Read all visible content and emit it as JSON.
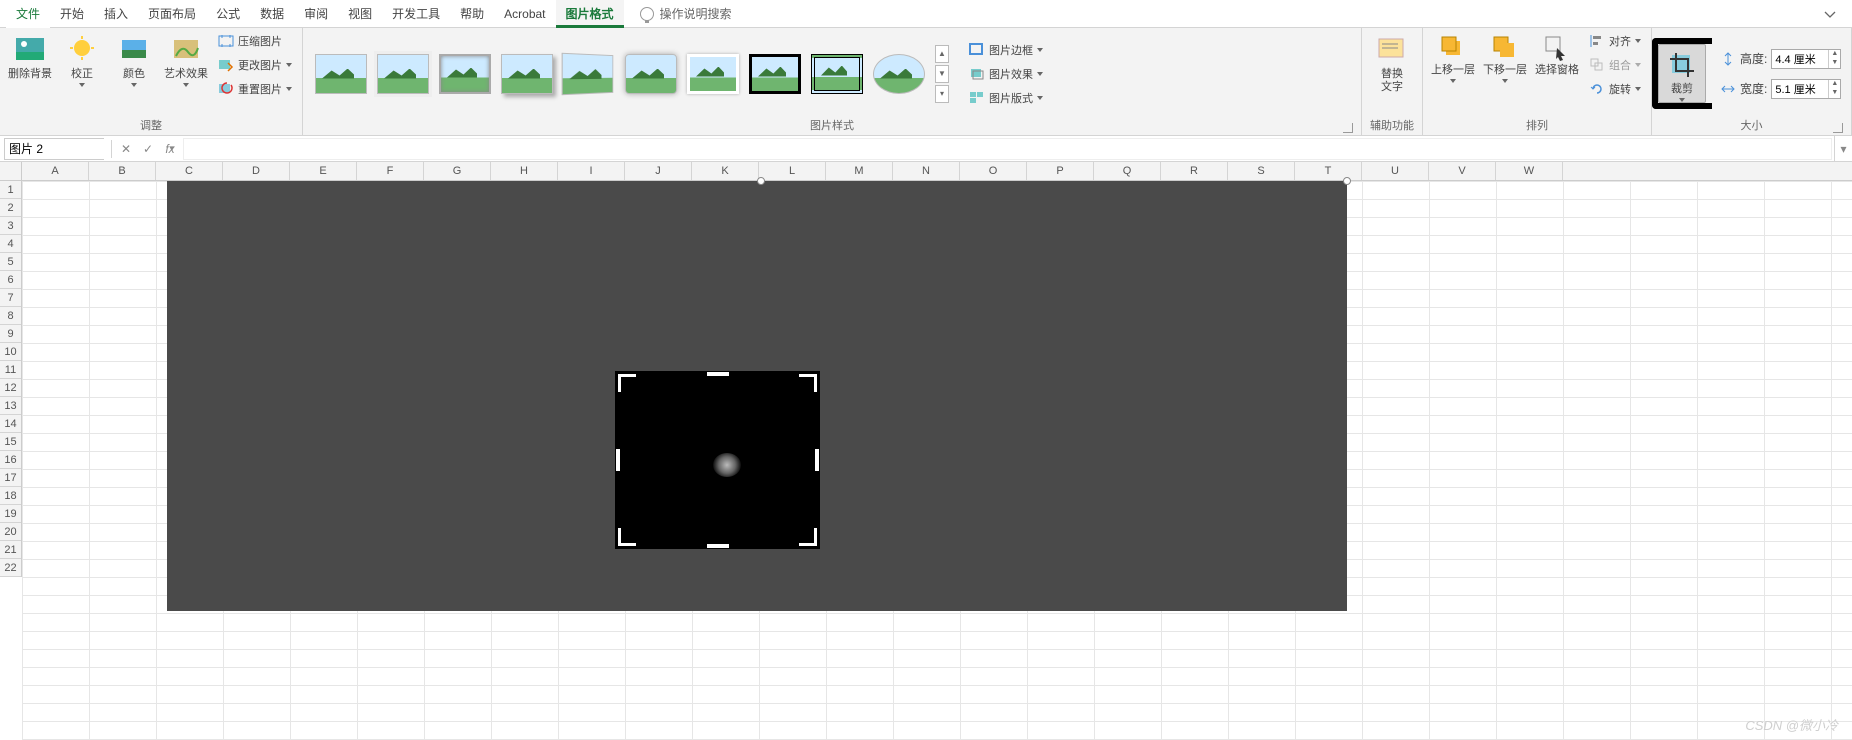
{
  "tabs": {
    "file": "文件",
    "items": [
      "开始",
      "插入",
      "页面布局",
      "公式",
      "数据",
      "审阅",
      "视图",
      "开发工具",
      "帮助",
      "Acrobat"
    ],
    "contextual": "图片格式",
    "tellme_placeholder": "操作说明搜索"
  },
  "ribbon": {
    "adjust": {
      "remove_bg": "删除背景",
      "corrections": "校正",
      "color": "颜色",
      "artistic": "艺术效果",
      "compress": "压缩图片",
      "change": "更改图片",
      "reset": "重置图片",
      "group_label": "调整"
    },
    "styles": {
      "group_label": "图片样式",
      "border": "图片边框",
      "effects": "图片效果",
      "layout": "图片版式"
    },
    "access": {
      "alt_text": "替换\n文字",
      "group_label": "辅助功能"
    },
    "arrange": {
      "bring_forward": "上移一层",
      "send_backward": "下移一层",
      "selection_pane": "选择窗格",
      "align": "对齐",
      "group": "组合",
      "rotate": "旋转",
      "group_label": "排列"
    },
    "size": {
      "crop": "裁剪",
      "height_label": "高度:",
      "height_value": "4.4 厘米",
      "width_label": "宽度:",
      "width_value": "5.1 厘米",
      "group_label": "大小"
    }
  },
  "fxbar": {
    "namebox_value": "图片 2",
    "fx_label": "fx"
  },
  "grid": {
    "columns": [
      "A",
      "B",
      "C",
      "D",
      "E",
      "F",
      "G",
      "H",
      "I",
      "J",
      "K",
      "L",
      "M",
      "N",
      "O",
      "P",
      "Q",
      "R",
      "S",
      "T",
      "U",
      "V",
      "W"
    ],
    "rows": [
      "1",
      "2",
      "3",
      "4",
      "5",
      "6",
      "7",
      "8",
      "9",
      "10",
      "11",
      "12",
      "13",
      "14",
      "15",
      "16",
      "17",
      "18",
      "19",
      "20",
      "21",
      "22"
    ]
  },
  "watermark": "CSDN @微小冷"
}
